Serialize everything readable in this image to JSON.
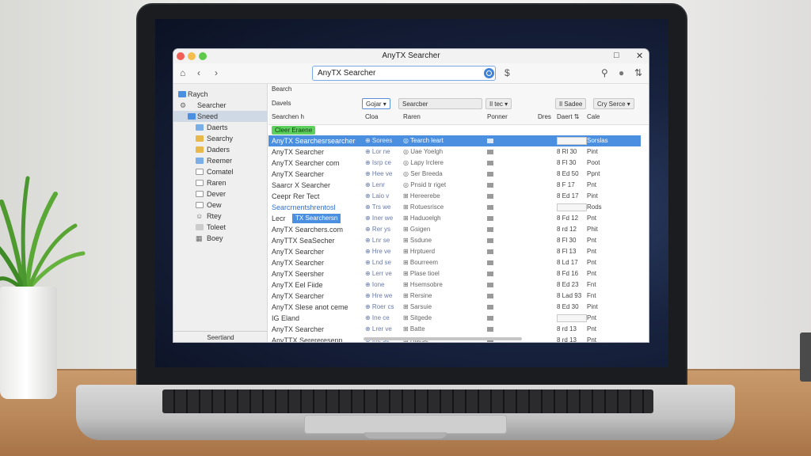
{
  "app": {
    "title": "AnyTX Searcher",
    "window_controls": {
      "maximize": "□",
      "close": "✕"
    }
  },
  "toolbar": {
    "home_icon": "⌂",
    "back_icon": "‹",
    "forward_icon": "›",
    "search_value": "AnyTX Searcher",
    "dollar": "$",
    "pin_icon": "⚲",
    "user_icon": "●",
    "sort_icon": "⇅"
  },
  "sidebar": {
    "items": [
      {
        "label": "Raych",
        "icon": "folder-blue"
      },
      {
        "label": "Searcher",
        "icon": "gear"
      },
      {
        "label": "Sneed",
        "icon": "folder-blue",
        "selected": true
      },
      {
        "label": "Daerts",
        "icon": "folder-blue"
      },
      {
        "label": "Searchy",
        "icon": "folder-yellow"
      },
      {
        "label": "Daders",
        "icon": "folder-yellow"
      },
      {
        "label": "Reemer",
        "icon": "folder-blue"
      },
      {
        "label": "Comatel",
        "icon": "document"
      },
      {
        "label": "Raren",
        "icon": "document"
      },
      {
        "label": "Dever",
        "icon": "document"
      },
      {
        "label": "Oew",
        "icon": "document"
      },
      {
        "label": "Rtey",
        "icon": "user"
      },
      {
        "label": "Toleet",
        "icon": "tray"
      },
      {
        "label": "Boey",
        "icon": "grid"
      }
    ],
    "footer": "Seertiand"
  },
  "main": {
    "header": {
      "section": "Bearch",
      "sub": "Davels",
      "field_label": "Searchen h",
      "chips": [
        "Gojar ▾",
        "Searcber",
        "Il tec ▾",
        "Il Sadee",
        "Cry Serce ▾"
      ],
      "col_headers": [
        "Cloa",
        "Raren",
        "Ponner",
        "Dres",
        "Daert ⇅",
        "Cale"
      ]
    },
    "tag": "Cleer Eraene",
    "selected_popup": "TX Searchersn",
    "rows": [
      {
        "name": "AnyTX Searchesrsearcher",
        "c2": "⊕ Sorees",
        "c3": "◎ Tearch leart",
        "c5": "",
        "c6": "Sorslas",
        "selected": true
      },
      {
        "name": "AnyTX Searcher",
        "c2": "⊕ Lor ne",
        "c3": "◎ Uae Yoelgh",
        "c5": "8 Rl 30",
        "c6": "Pint"
      },
      {
        "name": "AnyTX Searcher com",
        "c2": "⊕ Isrp ce",
        "c3": "◎ Lapy Irclere",
        "c5": "8 Fl 30",
        "c6": "Poot"
      },
      {
        "name": "AnyTX Searcher",
        "c2": "⊕ Hee ve",
        "c3": "◎ Ser Breeda",
        "c5": "8 Ed 50",
        "c6": "Ppnt"
      },
      {
        "name": "Saarcr X Searcher",
        "c2": "⊕ Lenr",
        "c3": "◎ Pnsid tr riget",
        "c5": "8 F 17",
        "c6": "Pnt"
      },
      {
        "name": "Ceepr Rer Tect",
        "c2": "⊕ Laio v",
        "c3": "⊞ Hereerebe",
        "c5": "8 Ed 17",
        "c6": "Pint"
      },
      {
        "name": "Searcrnentshrentosl",
        "c2": "⊕ Trs we",
        "c3": "⊞ Rotuesrisce",
        "c5": "",
        "c6": "Rods",
        "blue": true
      },
      {
        "name": "Lecr",
        "c2": "⊕ Iner we",
        "c3": "⊞ Haduoelgh",
        "c5": "8 Fd 12",
        "c6": "Pnt"
      },
      {
        "name": "AnyTX Searchers.com",
        "c2": "⊕ Rer ys",
        "c3": "⊞ Gsigen",
        "c5": "8 rd 12",
        "c6": "Phit"
      },
      {
        "name": "AnyTTX SeaSecher",
        "c2": "⊕ Lnr se",
        "c3": "⊞ Ssdune",
        "c5": "8 Fl 30",
        "c6": "Pnt"
      },
      {
        "name": "AnyTX Searcher",
        "c2": "⊕ Hre ve",
        "c3": "⊞ Hrptuerd",
        "c5": "8 Fl 13",
        "c6": "Pnt"
      },
      {
        "name": "AnyTX Searcher",
        "c2": "⊕ Lnd se",
        "c3": "⊞ Bourreem",
        "c5": "8 Ld 17",
        "c6": "Pnt"
      },
      {
        "name": "AnyTX Seersher",
        "c2": "⊕ Lerr ve",
        "c3": "⊞ Plase tioel",
        "c5": "8 Fd 16",
        "c6": "Pnt"
      },
      {
        "name": "AnyTX Eel Fiide",
        "c2": "⊕ Ione",
        "c3": "⊞ Hsemsobre",
        "c5": "8 Ed 23",
        "c6": "Fnt"
      },
      {
        "name": "AnyTX Searcher",
        "c2": "⊕ Hre we",
        "c3": "⊞ Rersine",
        "c5": "8 Lad 93",
        "c6": "Fnt"
      },
      {
        "name": "AnyTX Slese anot ceme",
        "c2": "⊕ Roer cs",
        "c3": "⊞ Sarsuie",
        "c5": "8 Ed 30",
        "c6": "Pint"
      },
      {
        "name": "IG Eland",
        "c2": "⊕ Ine ce",
        "c3": "⊞ Sitgede",
        "c5": "",
        "c6": "Pnt"
      },
      {
        "name": "AnyTX Searcher",
        "c2": "⊕ Lrer ve",
        "c3": "⊞ Batte",
        "c5": "8 rd 13",
        "c6": "Pnt"
      },
      {
        "name": "AnyTTX Serereresenn",
        "c2": "⊕ Ine se",
        "c3": "⊞ Haese",
        "c5": "8 rd 13",
        "c6": "Pnt"
      }
    ]
  },
  "colors": {
    "accent": "#4a8fe0",
    "tag_green": "#5ed05e"
  }
}
